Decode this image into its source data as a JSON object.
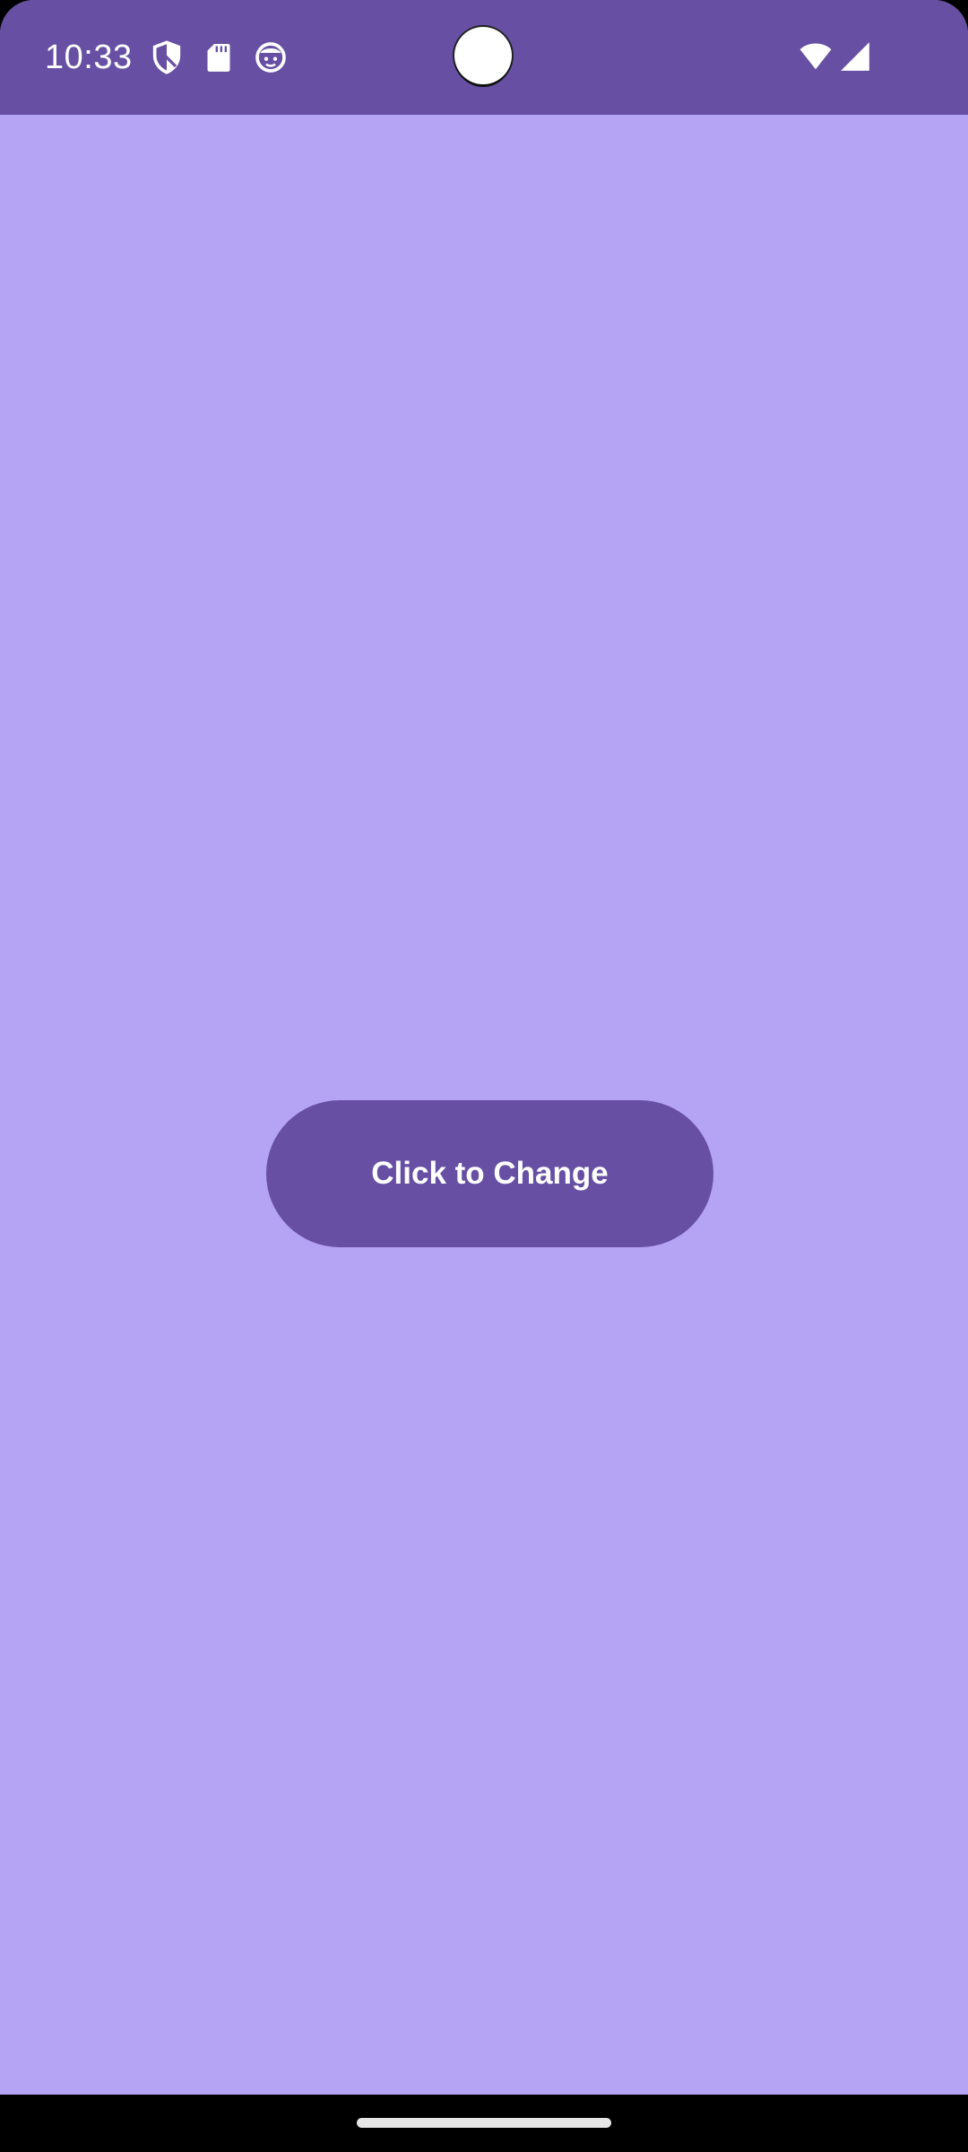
{
  "status_bar": {
    "time": "10:33",
    "icons": [
      "shield-icon",
      "sd-card-icon",
      "face-icon",
      "wifi-icon",
      "signal-icon"
    ],
    "background": "#6750a4"
  },
  "main": {
    "background": "#b5a3f3",
    "button": {
      "label": "Click to Change",
      "background": "#6750a4",
      "text_color": "#ffffff"
    }
  },
  "nav_bar": {
    "background": "#000000"
  }
}
